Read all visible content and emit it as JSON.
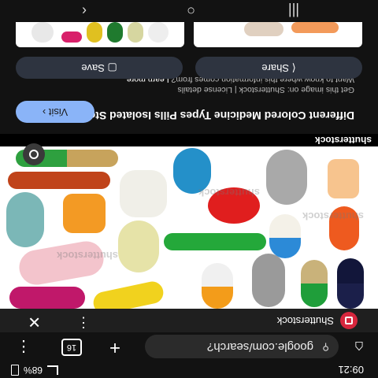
{
  "status": {
    "time": "09:21",
    "battery": "68%"
  },
  "browser": {
    "url": "google.com/search?",
    "tab_count": "16",
    "icons": [
      "home-icon",
      "site-settings-icon",
      "add-tab-icon",
      "tabs-icon",
      "menu-icon"
    ]
  },
  "panel": {
    "source": "Shutterstock",
    "close_icon": "close-icon",
    "more_icon": "more-vert-icon"
  },
  "image": {
    "watermark": "shutterstock",
    "label": "shutterstock"
  },
  "result": {
    "title": "Different Colored Medicine Types Pills Isolated Stock Photo ...",
    "visit_label": "Visit",
    "get_image": "Get this image on: Shutterstock | License details",
    "want_to_know": "Want to know where this information comes from?",
    "learn_more": "Learn more",
    "share_label": "Share",
    "save_label": "Save"
  },
  "colors": {
    "background": "#121212",
    "accent": "#8ab4f8",
    "button_bg": "#2e3440",
    "brand": "#d7263d"
  }
}
